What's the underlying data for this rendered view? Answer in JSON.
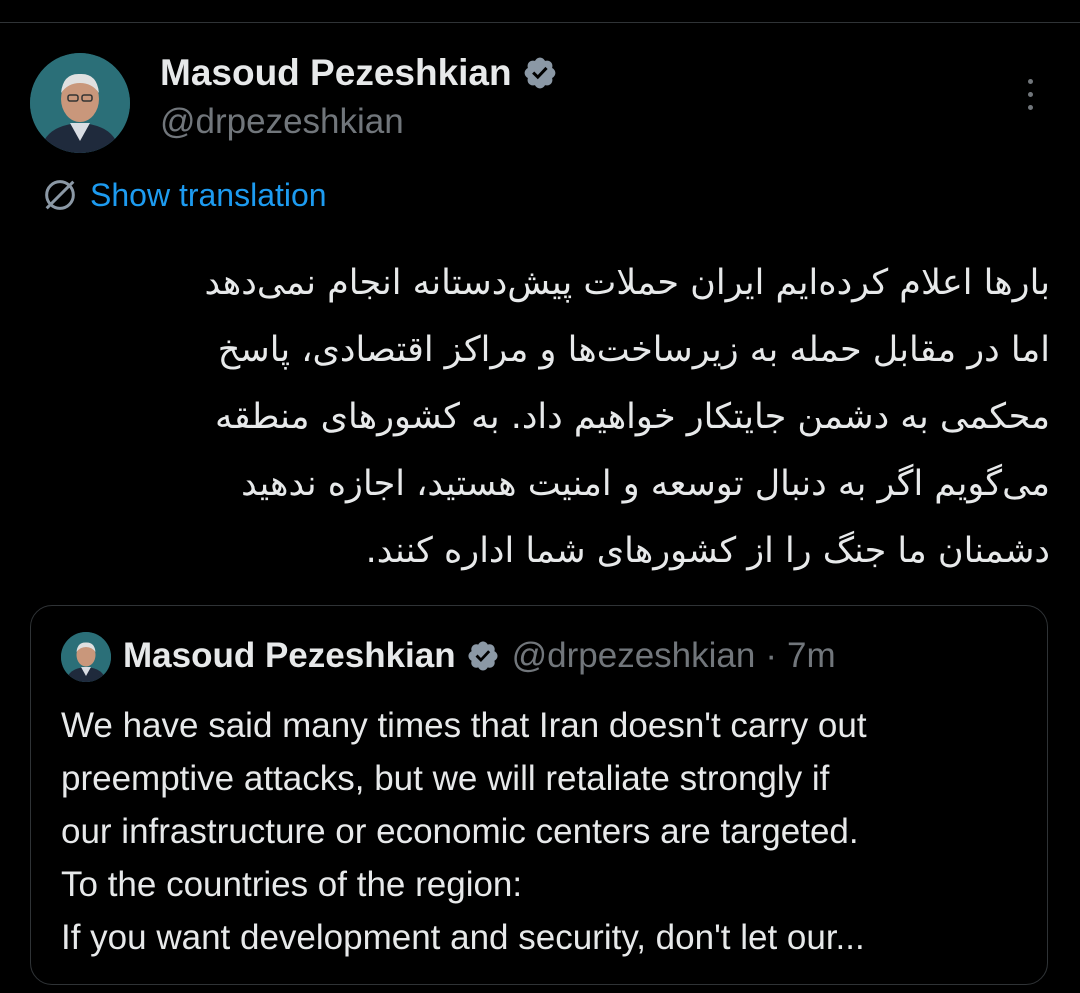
{
  "post": {
    "author_name": "Masoud Pezeshkian",
    "author_handle": "@drpezeshkian",
    "translate_label": "Show translation",
    "text_lines": [
      "بارها اعلام کرده‌ایم ایران حملات پیش‌دستانه انجام نمی‌دهد",
      "اما در مقابل حمله به زیرساخت‌ها و مراکز اقتصادی، پاسخ",
      "محکمی به دشمن جایتکار خواهیم داد. به کشورهای منطقه",
      "می‌گویم اگر به دنبال توسعه و امنیت هستید، اجازه ندهید",
      "دشمنان ما جنگ را از کشورهای شما اداره کنند."
    ]
  },
  "quoted": {
    "author_name": "Masoud Pezeshkian",
    "author_handle": "@drpezeshkian",
    "separator": "·",
    "time": "7m",
    "text_lines": [
      "We have said many times that Iran doesn't carry out",
      "preemptive attacks, but we will retaliate strongly if",
      "our infrastructure or economic centers are targeted.",
      "To the countries of the region:",
      "If you want development and security, don't let our..."
    ]
  },
  "icons": {
    "verified": "verified-badge-icon",
    "more": "more-options-icon",
    "translate": "globe-translate-icon"
  },
  "colors": {
    "background": "#000000",
    "text": "#e7e9ea",
    "secondary": "#71767b",
    "accent": "#1d9bf0",
    "border": "#2f3336"
  }
}
